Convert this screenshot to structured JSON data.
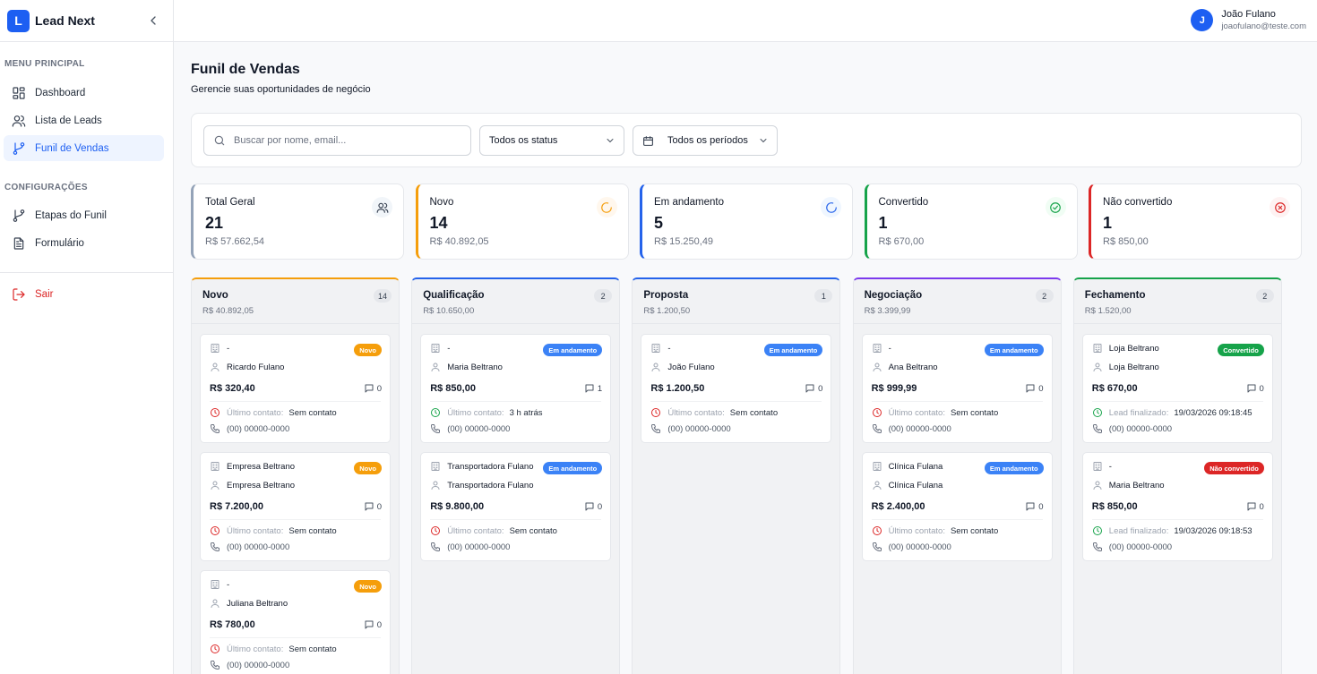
{
  "app": {
    "name": "Lead Next",
    "logo_letter": "L"
  },
  "sidebar": {
    "section_main": "MENU PRINCIPAL",
    "main_items": [
      {
        "label": "Dashboard",
        "icon": "grid-icon"
      },
      {
        "label": "Lista de Leads",
        "icon": "users-icon"
      },
      {
        "label": "Funil de Vendas",
        "icon": "git-branch-icon",
        "active": true
      }
    ],
    "section_config": "CONFIGURAÇÕES",
    "config_items": [
      {
        "label": "Etapas do Funil",
        "icon": "git-branch-icon"
      },
      {
        "label": "Formulário",
        "icon": "file-text-icon"
      }
    ],
    "logout": {
      "label": "Sair",
      "icon": "log-out-icon"
    }
  },
  "user": {
    "initial": "J",
    "name": "João Fulano",
    "email": "joaofulano@teste.com"
  },
  "page": {
    "title": "Funil de Vendas",
    "subtitle": "Gerencie suas oportunidades de negócio"
  },
  "filters": {
    "search_placeholder": "Buscar por nome, email...",
    "status_value": "Todos os status",
    "period_value": "Todos os períodos"
  },
  "stats": [
    {
      "label": "Total Geral",
      "count": "21",
      "amount": "R$ 57.662,54",
      "color": "#94a3b8",
      "icon": "users-icon"
    },
    {
      "label": "Novo",
      "count": "14",
      "amount": "R$ 40.892,05",
      "color": "#f59e0b",
      "icon": "loader-icon"
    },
    {
      "label": "Em andamento",
      "count": "5",
      "amount": "R$ 15.250,49",
      "color": "#2563eb",
      "icon": "loader-icon"
    },
    {
      "label": "Convertido",
      "count": "1",
      "amount": "R$ 670,00",
      "color": "#16a34a",
      "icon": "check-circle-icon"
    },
    {
      "label": "Não convertido",
      "count": "1",
      "amount": "R$ 850,00",
      "color": "#dc2626",
      "icon": "x-circle-icon"
    }
  ],
  "columns": [
    {
      "name": "Novo",
      "amount": "R$ 40.892,05",
      "count": "14",
      "color": "#f59e0b",
      "cards": [
        {
          "company": "-",
          "contact": "Ricardo Fulano",
          "badge": "Novo",
          "badge_color": "#f59e0b",
          "value": "R$ 320,40",
          "comments": "0",
          "status_label": "Último contato:",
          "status_value": "Sem contato",
          "status_tone": "red",
          "phone": "(00) 00000-0000"
        },
        {
          "company": "Empresa Beltrano",
          "contact": "Empresa Beltrano",
          "badge": "Novo",
          "badge_color": "#f59e0b",
          "value": "R$ 7.200,00",
          "comments": "0",
          "status_label": "Último contato:",
          "status_value": "Sem contato",
          "status_tone": "red",
          "phone": "(00) 00000-0000"
        },
        {
          "company": "-",
          "contact": "Juliana Beltrano",
          "badge": "Novo",
          "badge_color": "#f59e0b",
          "value": "R$ 780,00",
          "comments": "0",
          "status_label": "Último contato:",
          "status_value": "Sem contato",
          "status_tone": "red",
          "phone": "(00) 00000-0000"
        }
      ]
    },
    {
      "name": "Qualificação",
      "amount": "R$ 10.650,00",
      "count": "2",
      "color": "#2563eb",
      "cards": [
        {
          "company": "-",
          "contact": "Maria Beltrano",
          "badge": "Em andamento",
          "badge_color": "#3b82f6",
          "value": "R$ 850,00",
          "comments": "1",
          "status_label": "Último contato:",
          "status_value": "3 h atrás",
          "status_tone": "green",
          "phone": "(00) 00000-0000"
        },
        {
          "company": "Transportadora Fulano",
          "contact": "Transportadora Fulano",
          "badge": "Em andamento",
          "badge_color": "#3b82f6",
          "value": "R$ 9.800,00",
          "comments": "0",
          "status_label": "Último contato:",
          "status_value": "Sem contato",
          "status_tone": "red",
          "phone": "(00) 00000-0000"
        }
      ]
    },
    {
      "name": "Proposta",
      "amount": "R$ 1.200,50",
      "count": "1",
      "color": "#2563eb",
      "cards": [
        {
          "company": "-",
          "contact": "João Fulano",
          "badge": "Em andamento",
          "badge_color": "#3b82f6",
          "value": "R$ 1.200,50",
          "comments": "0",
          "status_label": "Último contato:",
          "status_value": "Sem contato",
          "status_tone": "red",
          "phone": "(00) 00000-0000"
        }
      ]
    },
    {
      "name": "Negociação",
      "amount": "R$ 3.399,99",
      "count": "2",
      "color": "#7c3aed",
      "cards": [
        {
          "company": "-",
          "contact": "Ana Beltrano",
          "badge": "Em andamento",
          "badge_color": "#3b82f6",
          "value": "R$ 999,99",
          "comments": "0",
          "status_label": "Último contato:",
          "status_value": "Sem contato",
          "status_tone": "red",
          "phone": "(00) 00000-0000"
        },
        {
          "company": "Clínica Fulana",
          "contact": "Clínica Fulana",
          "badge": "Em andamento",
          "badge_color": "#3b82f6",
          "value": "R$ 2.400,00",
          "comments": "0",
          "status_label": "Último contato:",
          "status_value": "Sem contato",
          "status_tone": "red",
          "phone": "(00) 00000-0000"
        }
      ]
    },
    {
      "name": "Fechamento",
      "amount": "R$ 1.520,00",
      "count": "2",
      "color": "#16a34a",
      "cards": [
        {
          "company": "Loja Beltrano",
          "contact": "Loja Beltrano",
          "badge": "Convertido",
          "badge_color": "#16a34a",
          "value": "R$ 670,00",
          "comments": "0",
          "status_label": "Lead finalizado:",
          "status_value": "19/03/2026 09:18:45",
          "status_tone": "green",
          "phone": "(00) 00000-0000"
        },
        {
          "company": "-",
          "contact": "Maria Beltrano",
          "badge": "Não convertido",
          "badge_color": "#dc2626",
          "value": "R$ 850,00",
          "comments": "0",
          "status_label": "Lead finalizado:",
          "status_value": "19/03/2026 09:18:53",
          "status_tone": "green",
          "phone": "(00) 00000-0000"
        }
      ]
    }
  ]
}
